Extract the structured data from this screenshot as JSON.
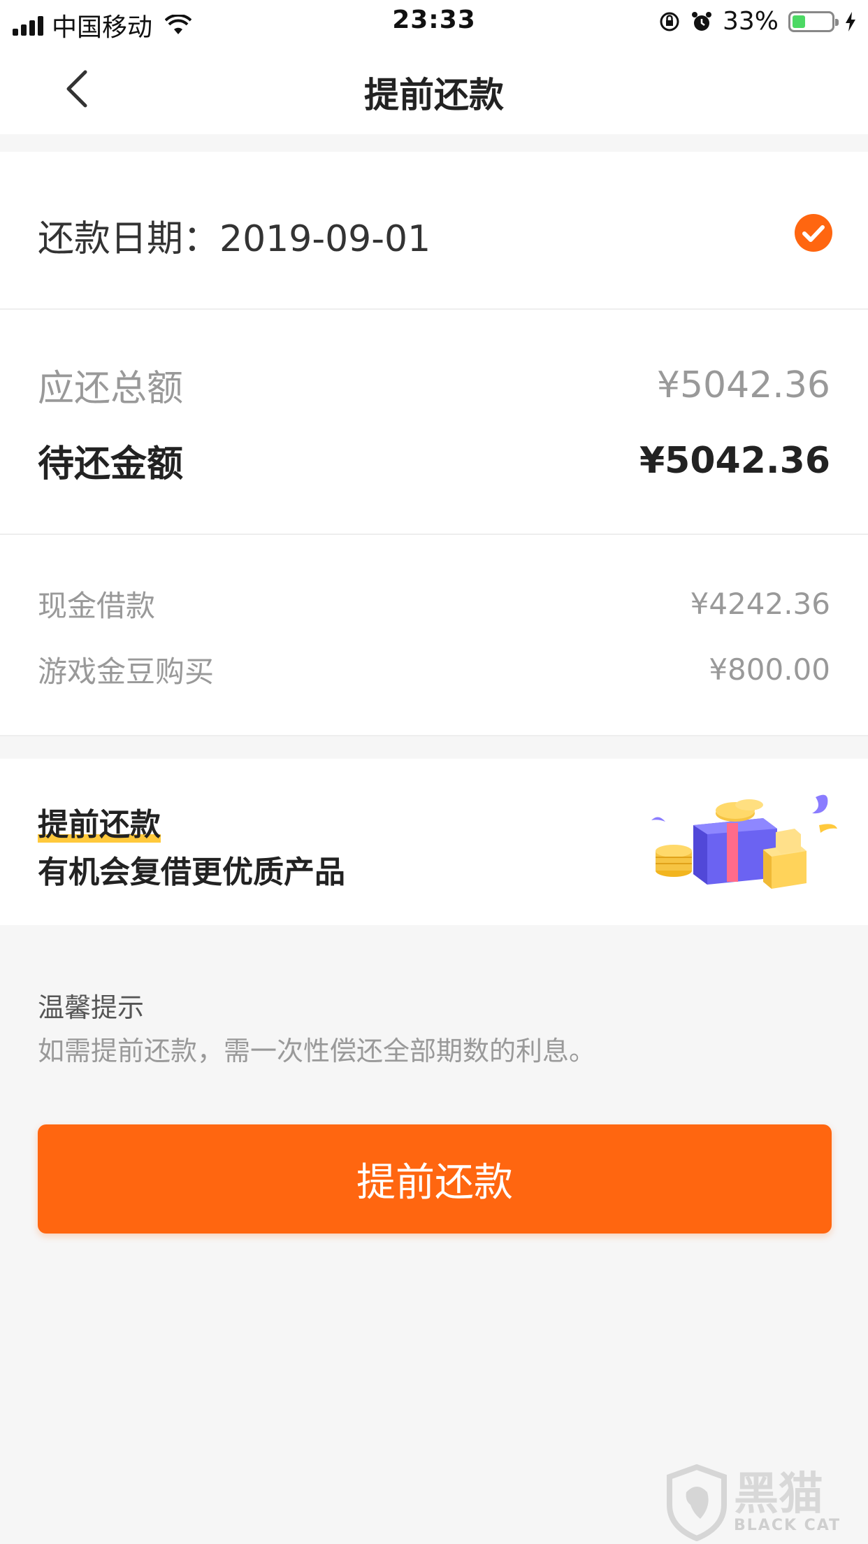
{
  "status_bar": {
    "carrier": "中国移动",
    "time": "23:33",
    "battery_percent": "33%",
    "battery_level": 0.33
  },
  "navbar": {
    "title": "提前还款"
  },
  "repayment_date": {
    "text": "还款日期：2019-09-01",
    "selected": true
  },
  "amounts": {
    "total_label": "应还总额",
    "total_value": "¥5042.36",
    "pending_label": "待还金额",
    "pending_value": "¥5042.36"
  },
  "details": [
    {
      "label": "现金借款",
      "value": "¥4242.36"
    },
    {
      "label": "游戏金豆购买",
      "value": "¥800.00"
    }
  ],
  "promo": {
    "title": "提前还款",
    "subtitle": "有机会复借更优质产品"
  },
  "tips": {
    "title": "温馨提示",
    "text": "如需提前还款，需一次性偿还全部期数的利息。"
  },
  "action": {
    "button_label": "提前还款"
  },
  "watermark": {
    "cn": "黑猫",
    "en": "BLACK CAT"
  },
  "colors": {
    "accent": "#ff6610",
    "highlight": "#ffc93c",
    "battery": "#4cd964"
  }
}
